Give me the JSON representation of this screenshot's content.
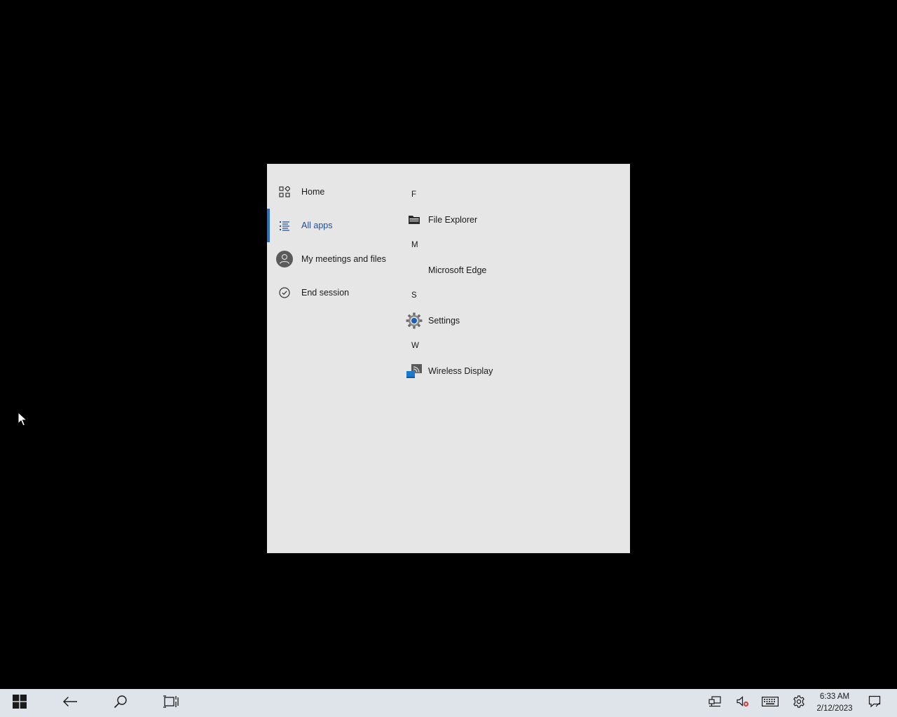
{
  "start_menu": {
    "nav": [
      {
        "label": "Home",
        "icon": "home-grid-icon"
      },
      {
        "label": "All apps",
        "icon": "list-icon",
        "selected": true
      },
      {
        "label": "My meetings and files",
        "icon": "avatar-icon"
      },
      {
        "label": "End session",
        "icon": "check-circle-icon"
      }
    ],
    "apps": {
      "groups": [
        {
          "letter": "F",
          "items": [
            {
              "label": "File Explorer",
              "icon": "file-explorer-icon"
            }
          ]
        },
        {
          "letter": "M",
          "items": [
            {
              "label": "Microsoft Edge",
              "icon": "edge-icon"
            }
          ]
        },
        {
          "letter": "S",
          "items": [
            {
              "label": "Settings",
              "icon": "settings-gear-icon"
            }
          ]
        },
        {
          "letter": "W",
          "items": [
            {
              "label": "Wireless Display",
              "icon": "wireless-display-icon"
            }
          ]
        }
      ]
    }
  },
  "taskbar": {
    "clock": {
      "time": "6:33 AM",
      "date": "2/12/2023"
    },
    "accent_color": "#2f6fc4",
    "background_color": "#dfe3ea"
  }
}
